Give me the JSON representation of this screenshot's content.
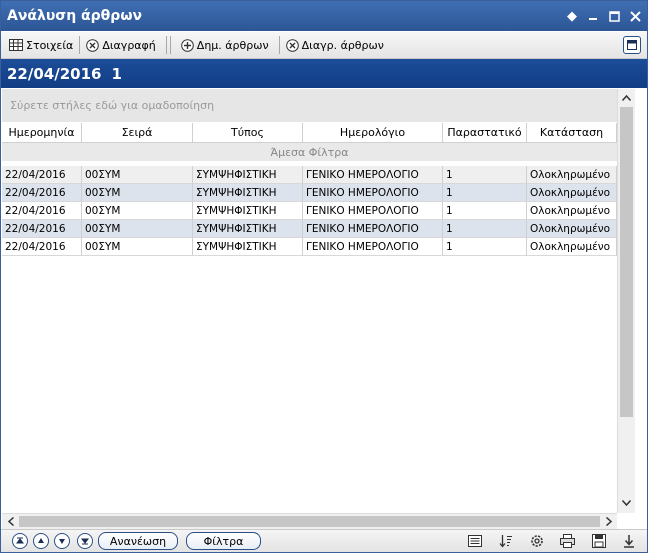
{
  "window": {
    "title": "Ανάλυση άρθρων"
  },
  "toolbar": {
    "items": [
      {
        "label": "Στοιχεία",
        "icon": "grid-icon"
      },
      {
        "label": "Διαγραφή",
        "icon": "delete-circle-icon"
      },
      {
        "label": "Δημ. άρθρων",
        "icon": "add-circle-icon"
      },
      {
        "label": "Διαγρ. άρθρων",
        "icon": "delete-circle-icon"
      }
    ]
  },
  "header": {
    "date": "22/04/2016",
    "number": "1"
  },
  "grid": {
    "group_placeholder": "Σύρετε στήλες εδώ για ομαδοποίηση",
    "filter_row_label": "Άμεσα Φίλτρα",
    "columns": [
      "Ημερομηνία",
      "Σειρά",
      "Τύπος",
      "Ημερολόγιο",
      "Παραστατικό",
      "Κατάσταση"
    ],
    "rows": [
      [
        "22/04/2016",
        "00ΣΥΜ",
        "ΣΥΜΨΗΦΙΣΤΙΚΗ",
        "ΓΕΝΙΚΟ ΗΜΕΡΟΛΟΓΙΟ",
        "1",
        "Ολοκληρωμένο"
      ],
      [
        "22/04/2016",
        "00ΣΥΜ",
        "ΣΥΜΨΗΦΙΣΤΙΚΗ",
        "ΓΕΝΙΚΟ ΗΜΕΡΟΛΟΓΙΟ",
        "1",
        "Ολοκληρωμένο"
      ],
      [
        "22/04/2016",
        "00ΣΥΜ",
        "ΣΥΜΨΗΦΙΣΤΙΚΗ",
        "ΓΕΝΙΚΟ ΗΜΕΡΟΛΟΓΙΟ",
        "1",
        "Ολοκληρωμένο"
      ],
      [
        "22/04/2016",
        "00ΣΥΜ",
        "ΣΥΜΨΗΦΙΣΤΙΚΗ",
        "ΓΕΝΙΚΟ ΗΜΕΡΟΛΟΓΙΟ",
        "1",
        "Ολοκληρωμένο"
      ],
      [
        "22/04/2016",
        "00ΣΥΜ",
        "ΣΥΜΨΗΦΙΣΤΙΚΗ",
        "ΓΕΝΙΚΟ ΗΜΕΡΟΛΟΓΙΟ",
        "1",
        "Ολοκληρωμένο"
      ]
    ]
  },
  "bottombar": {
    "refresh_label": "Ανανέωση",
    "filters_label": "Φίλτρα"
  },
  "colors": {
    "title_bar": "#2c5696",
    "header_band": "#113d85",
    "alt_row": "#dce3ec"
  }
}
